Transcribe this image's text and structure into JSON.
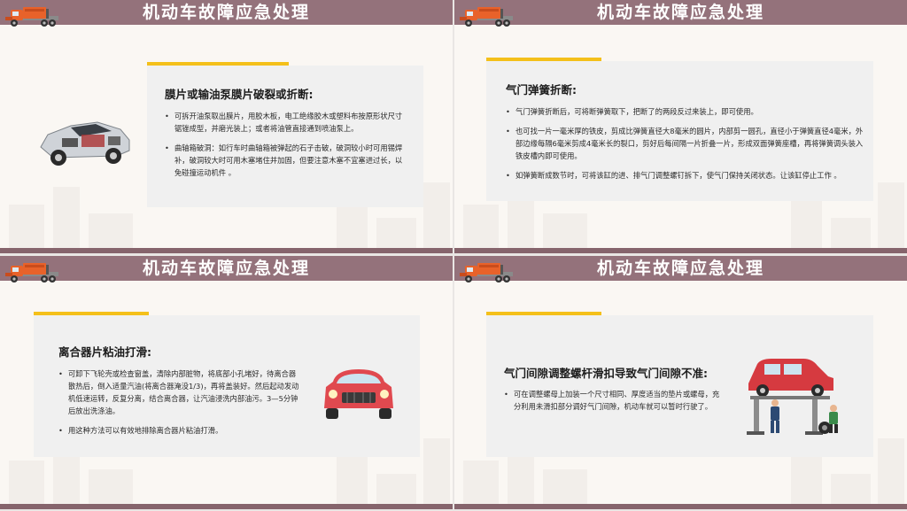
{
  "header_title": "机动车故障应急处理",
  "slides": [
    {
      "card_title": "膜片或输油泵膜片破裂或折断:",
      "bullets": [
        "可拆开油泵取出膜片，用胶木板，电工绝缘胶木或塑料布按原形状尺寸锯锉成型，并磨光装上；或者将油管直接通到喷油泵上。",
        "曲轴箱破洞：如行车时曲轴箱被弹起的石子击破，破洞较小时可用锡焊补，破洞较大时可用木塞堵住并加固，但要注意木塞不宜塞进过长，以免碰撞运动机件 。"
      ]
    },
    {
      "card_title": "气门弹簧折断:",
      "bullets": [
        "气门弹簧折断后，可将断弹簧取下，把断了的两段反过来装上，即可使用。",
        "也可找一片一毫米厚的铁皮，剪成比弹簧直径大8毫米的圆片，内部剪一圆孔，直径小于弹簧直径4毫米，外部边缘每隔6毫米剪成4毫米长的裂口，剪好后每间隔一片折叠一片，形成双面弹簧座槽，再将弹簧调头装入铁皮槽内即可使用。",
        "如弹簧断成数节时，可将该缸的进、排气门调整螺钉拆下，使气门保持关闭状态。让该缸停止工作 。"
      ]
    },
    {
      "card_title": "离合器片粘油打滑:",
      "bullets": [
        "可卸下飞轮壳或检查窗盖，清除内部脏物，将底部小孔堵好，待离合器散热后，倒入适量汽油(将离合器淹没1/3)，再将盖装好。然后起动发动机低速运转，反复分离，结合离合器，让汽油浸洗内部油污。3—5分钟后放出洗涤油。",
        "用这种方法可以有效地排除离合器片粘油打滑。"
      ]
    },
    {
      "card_title": "气门间隙调整螺杆滑扣导致气门间隙不准:",
      "bullets": [
        "可在调整螺母上加装一个尺寸相同、厚度适当的垫片或螺母，充分利用未滑扣部分调好气门间隙，机动车就可以暂时行驶了。"
      ]
    }
  ],
  "colors": {
    "header": "#94727b",
    "accent": "#f4c01a",
    "card": "#f0f0f0",
    "slide_bg": "#faf7f3",
    "truck": "#e8622a"
  },
  "icons": [
    "truck-icon",
    "car-engine-illustration",
    "red-car-front-illustration",
    "car-lift-mechanics-illustration"
  ]
}
